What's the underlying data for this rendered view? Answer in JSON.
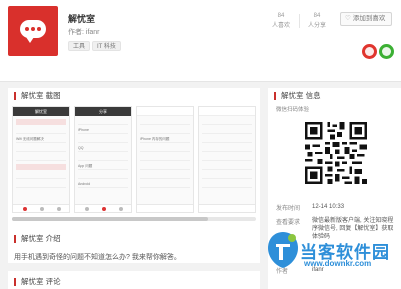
{
  "app": {
    "name": "解忧室",
    "author": "作者: ifanr",
    "tags": [
      "工具",
      "IT 科技"
    ]
  },
  "stats": [
    {
      "num": "84",
      "label": "人喜欢"
    },
    {
      "num": "84",
      "label": "人分享"
    }
  ],
  "actions": {
    "subscribe_icon": "heart-icon",
    "subscribe_label": "添加到喜欢"
  },
  "sections": {
    "screenshots_title": "解忧室 截图",
    "intro_title": "解忧室 介绍",
    "intro_text": "用手机遇到奇怪的问题不知道怎么办? 我来帮你解答。",
    "comments_title": "解忧室 评论",
    "info_title": "解忧室 信息"
  },
  "phones": [
    {
      "title": "解忧室",
      "rows": [
        "",
        "",
        "Wifi 无线问题解决",
        "",
        "",
        "",
        "",
        ""
      ]
    },
    {
      "title": "分享",
      "rows": [
        "",
        "iPhone",
        "",
        "QQ",
        "",
        "App 问题",
        "",
        "Android"
      ]
    },
    {
      "title": "",
      "rows": [
        "",
        "",
        "iPhone 内存的问题",
        "",
        "",
        "",
        "",
        ""
      ]
    },
    {
      "title": "",
      "rows": [
        "",
        "",
        "",
        "",
        "",
        "",
        "",
        ""
      ]
    }
  ],
  "info": {
    "qr_caption": "微信扫码体验",
    "rows": [
      {
        "label": "发布时间",
        "value": "12-14 10:33"
      },
      {
        "label": "查看要求",
        "value": "微信最新版客户端, 关注知晓程序微信号, 回复【解忧室】获取体验码"
      },
      {
        "label": "作者",
        "value": "ifanr"
      }
    ]
  },
  "watermark": {
    "text": "当客软件园",
    "url": "www.downkr.com"
  },
  "colors": {
    "brand_red": "#d9302c",
    "weibo_red": "#e0352e",
    "wechat_green": "#3cb034",
    "watermark_blue": "#2e8fd9"
  }
}
